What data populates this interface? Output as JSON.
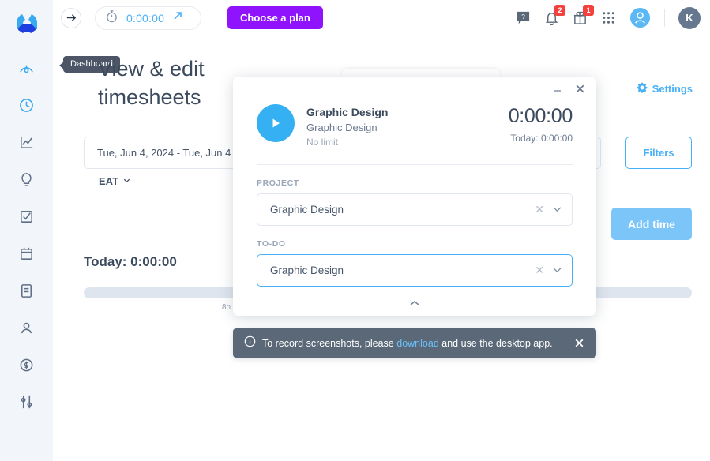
{
  "header": {
    "timer_value": "0:00:00",
    "plan_button": "Choose a plan",
    "help_icon": "help-icon",
    "bell_badge": "2",
    "gift_badge": "1",
    "avatar_initial": "K"
  },
  "sidebar": {
    "items": [
      {
        "name": "dashboard",
        "icon": "gauge-icon",
        "active": true
      },
      {
        "name": "time-tracker",
        "icon": "clock-icon",
        "active": true
      },
      {
        "name": "reports",
        "icon": "chart-icon",
        "active": false
      },
      {
        "name": "insights",
        "icon": "lightbulb-icon",
        "active": false
      },
      {
        "name": "tasks",
        "icon": "checkbox-icon",
        "active": false
      },
      {
        "name": "schedule",
        "icon": "calendar-icon",
        "active": false
      },
      {
        "name": "documents",
        "icon": "document-icon",
        "active": false
      },
      {
        "name": "people",
        "icon": "user-icon",
        "active": false
      },
      {
        "name": "expenses",
        "icon": "dollar-circle-icon",
        "active": false
      },
      {
        "name": "settings",
        "icon": "sliders-icon",
        "active": false
      }
    ]
  },
  "page": {
    "tooltip": "Dashboard",
    "title": "View & edit timesheets",
    "settings_label": "Settings",
    "date_range": "Tue, Jun 4, 2024 - Tue, Jun 4",
    "filters_label": "Filters",
    "timezone": "EAT",
    "add_time_label": "Add time",
    "today_total": "Today: 0:00:00",
    "progress_mark": "8h"
  },
  "modal": {
    "title": "Graphic Design",
    "subtitle": "Graphic Design",
    "note": "No limit",
    "timer": "0:00:00",
    "today_timer": "Today: 0:00:00",
    "project_label": "PROJECT",
    "project_value": "Graphic Design",
    "todo_label": "TO-DO",
    "todo_value": "Graphic Design"
  },
  "toast": {
    "text_before": "To record screenshots, please",
    "link": "download",
    "text_after": "and use the desktop app."
  },
  "colors": {
    "accent_blue": "#48b0f7",
    "play_blue": "#35b0f3",
    "plan_purple": "#9013fe",
    "badge_red": "#f5413e",
    "toast_bg": "#5a6878",
    "sidebar_bg": "#f2f5fa"
  }
}
